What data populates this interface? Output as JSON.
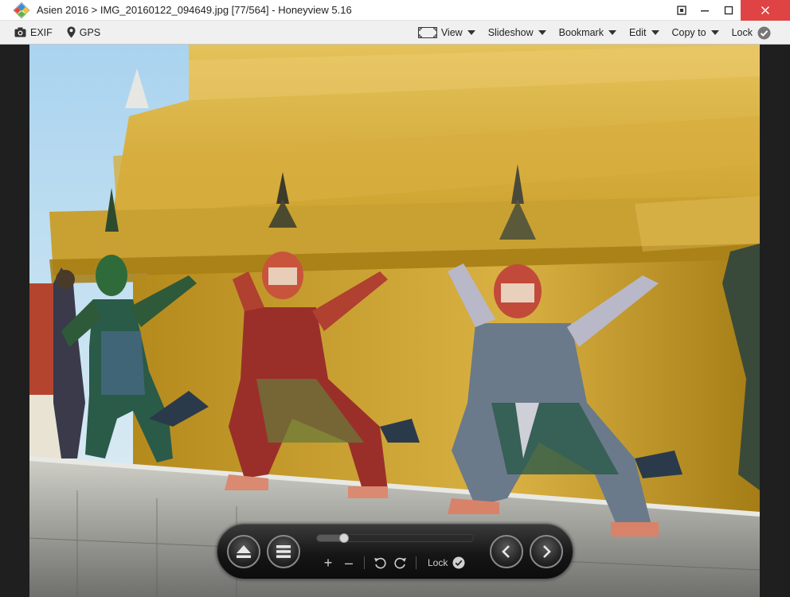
{
  "window": {
    "title": "Asien 2016 > IMG_20160122_094649.jpg [77/564] - Honeyview 5.16",
    "controls": {
      "pin": "⧈",
      "minimize": "–",
      "maximize": "□",
      "close": "✕"
    }
  },
  "toolbar": {
    "left": [
      {
        "label": "EXIF",
        "icon": "camera-icon"
      },
      {
        "label": "GPS",
        "icon": "map-pin-icon"
      }
    ],
    "right": {
      "view": "View",
      "slideshow": "Slideshow",
      "bookmark": "Bookmark",
      "edit": "Edit",
      "copy_to": "Copy to",
      "lock": "Lock"
    }
  },
  "image": {
    "subject": "photo-golden-chedi-with-demon-guardian-statues"
  },
  "controlbar": {
    "slider_position": 0.15,
    "zoom_in": "+",
    "zoom_out": "–",
    "lock": "Lock"
  },
  "colors": {
    "close_button": "#e04343",
    "gold": "#c9a227",
    "controlbar_bg": "#161616"
  }
}
